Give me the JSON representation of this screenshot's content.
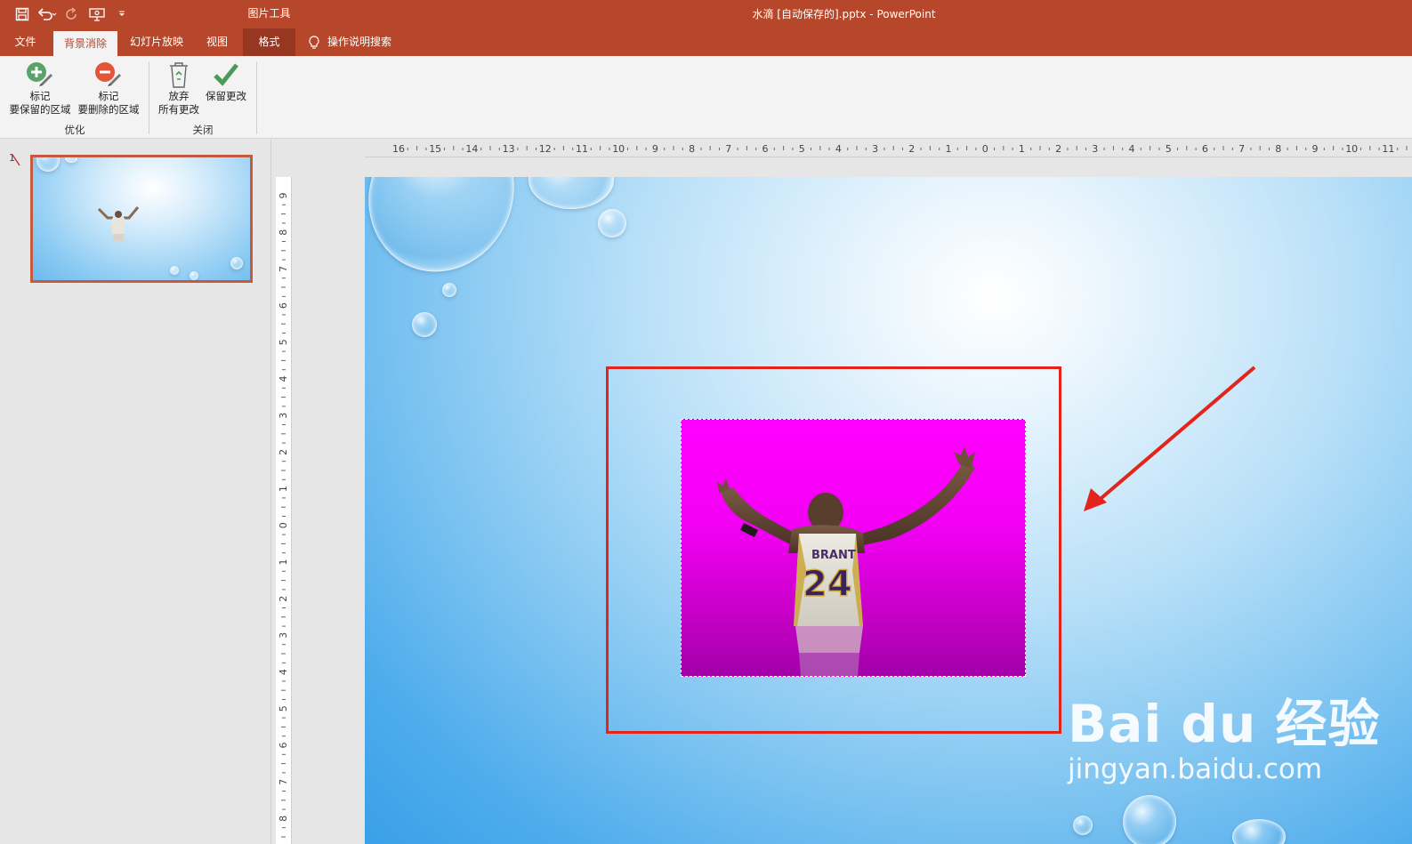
{
  "titlebar": {
    "window_title": "水滴 [自动保存的].pptx  -  PowerPoint",
    "context_tools_label": "图片工具",
    "qat_icons": [
      "save-icon",
      "undo-icon",
      "redo-icon",
      "present-icon",
      "customize-icon"
    ]
  },
  "tabs": {
    "file": "文件",
    "background_removal": "背景消除",
    "slideshow": "幻灯片放映",
    "view": "视图",
    "format": "格式",
    "tell_me": "操作说明搜索"
  },
  "ribbon": {
    "mark_keep_line1": "标记",
    "mark_keep_line2": "要保留的区域",
    "mark_remove_line1": "标记",
    "mark_remove_line2": "要删除的区域",
    "refine_group": "优化",
    "discard_line1": "放弃",
    "discard_line2": "所有更改",
    "keep_changes": "保留更改",
    "close_group": "关闭"
  },
  "slides_pane": {
    "slide_number": "1"
  },
  "rulers": {
    "horizontal_ticks": [
      "16",
      "15",
      "14",
      "13",
      "12",
      "11",
      "10",
      "9",
      "8",
      "7",
      "6",
      "5",
      "4",
      "3",
      "2",
      "1",
      "0",
      "1",
      "2",
      "3",
      "4",
      "5",
      "6",
      "7",
      "8",
      "9",
      "10",
      "11"
    ],
    "vertical_ticks": [
      "9",
      "8",
      "7",
      "6",
      "5",
      "4",
      "3",
      "2",
      "1",
      "0",
      "1",
      "2",
      "3",
      "4",
      "5",
      "6",
      "7",
      "8"
    ]
  },
  "slide": {
    "jersey_name": "BRANT",
    "jersey_number": "24"
  },
  "watermark": {
    "brand": "Bai du 经验",
    "url": "jingyan.baidu.com"
  },
  "colors": {
    "accent": "#b7472a",
    "highlight_box": "#e3241b",
    "removal_overlay": "#ff00ff"
  }
}
